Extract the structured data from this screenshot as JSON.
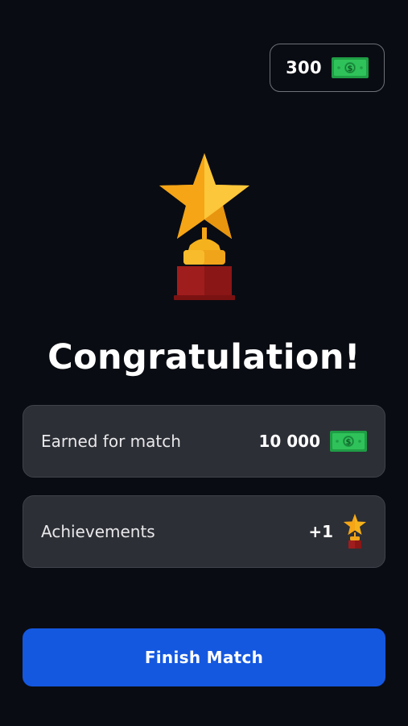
{
  "header": {
    "balance": "300",
    "balance_icon": "cash-bill-icon"
  },
  "hero": {
    "icon": "star-trophy-icon",
    "title": "Congratulation!"
  },
  "results": {
    "earned": {
      "label": "Earned for match",
      "value": "10 000",
      "icon": "cash-bill-icon"
    },
    "achievements": {
      "label": "Achievements",
      "value": "+1",
      "icon": "star-trophy-icon"
    }
  },
  "actions": {
    "finish_label": "Finish Match"
  },
  "colors": {
    "background": "#0a0c13",
    "card": "#2d2f36",
    "button": "#1558e0",
    "bill_green": "#22c55e",
    "star_gold": "#fbbf24",
    "trophy_red": "#9b1c1c"
  }
}
